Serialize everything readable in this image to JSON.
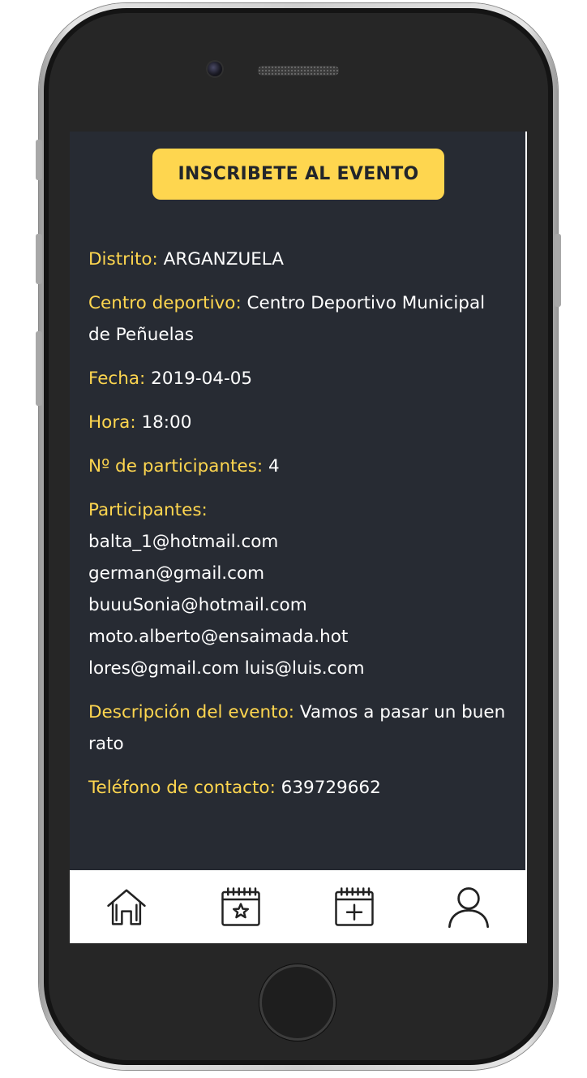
{
  "event": {
    "cta_label": "INSCRIBETE AL EVENTO",
    "distrito_label": "Distrito:",
    "distrito_value": "ARGANZUELA",
    "centro_label": "Centro deportivo:",
    "centro_value": "Centro Deportivo Municipal de Peñuelas",
    "fecha_label": "Fecha:",
    "fecha_value": "2019-04-05",
    "hora_label": "Hora:",
    "hora_value": "18:00",
    "num_participantes_label": "Nº de participantes:",
    "num_participantes_value": "4",
    "participantes_label": "Participantes:",
    "participantes": [
      "balta_1@hotmail.com",
      "german@gmail.com",
      "buuuSonia@hotmail.com",
      "moto.alberto@ensaimada.hot",
      "lores@gmail.com luis@luis.com"
    ],
    "descripcion_label": "Descripción del evento:",
    "descripcion_value": "Vamos a pasar un buen rato",
    "telefono_label": "Teléfono de contacto:",
    "telefono_value": "639729662"
  },
  "tabbar": {
    "items": [
      {
        "icon": "home-icon"
      },
      {
        "icon": "calendar-star-icon"
      },
      {
        "icon": "calendar-plus-icon"
      },
      {
        "icon": "user-icon"
      }
    ]
  },
  "colors": {
    "accent": "#fed64f",
    "screen_background": "#272b33",
    "text": "#ffffff"
  }
}
